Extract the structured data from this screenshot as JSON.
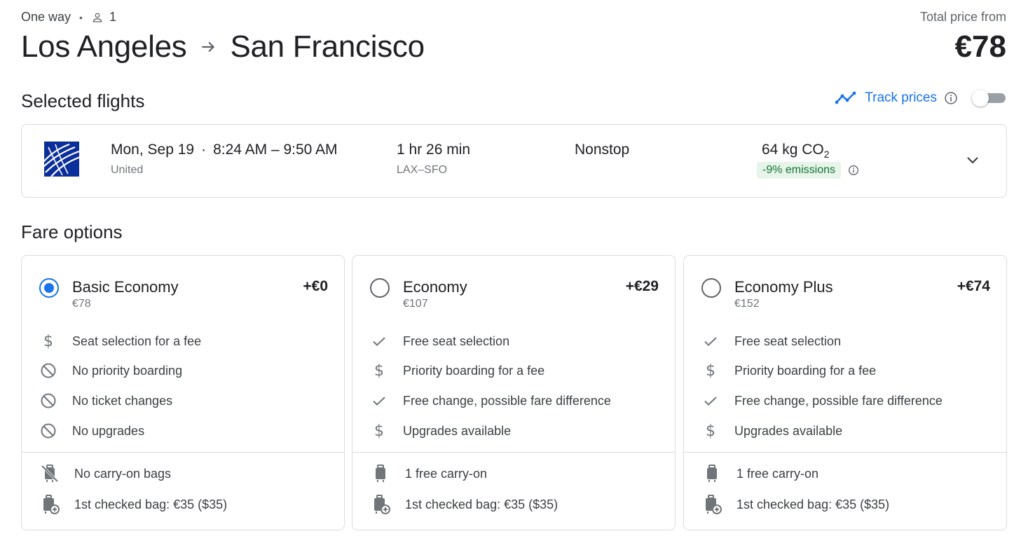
{
  "header": {
    "trip_type": "One way",
    "passengers": "1",
    "origin": "Los Angeles",
    "destination": "San Francisco",
    "total_label": "Total price from",
    "total_price": "€78"
  },
  "selected": {
    "title": "Selected flights",
    "track_label": "Track prices",
    "track_enabled": false
  },
  "flight": {
    "date": "Mon, Sep 19",
    "times": "8:24 AM – 9:50 AM",
    "airline": "United",
    "duration": "1 hr 26 min",
    "airports": "LAX–SFO",
    "stops": "Nonstop",
    "co2_value": "64 kg CO",
    "co2_sub": "2",
    "emissions": "-9% emissions"
  },
  "fare": {
    "title": "Fare options",
    "cards": [
      {
        "name": "Basic Economy",
        "base": "€78",
        "delta": "+€0",
        "selected": true,
        "features": [
          {
            "icon": "dollar-icon",
            "text": "Seat selection for a fee"
          },
          {
            "icon": "block-icon",
            "text": "No priority boarding"
          },
          {
            "icon": "block-icon",
            "text": "No ticket changes"
          },
          {
            "icon": "block-icon",
            "text": "No upgrades"
          }
        ],
        "bags": [
          {
            "icon": "no-carry-on-icon",
            "text": "No carry-on bags"
          },
          {
            "icon": "checked-bag-icon",
            "text": "1st checked bag: €35 ($35)"
          }
        ]
      },
      {
        "name": "Economy",
        "base": "€107",
        "delta": "+€29",
        "selected": false,
        "features": [
          {
            "icon": "check-icon",
            "text": "Free seat selection"
          },
          {
            "icon": "dollar-icon",
            "text": "Priority boarding for a fee"
          },
          {
            "icon": "check-icon",
            "text": "Free change, possible fare difference"
          },
          {
            "icon": "dollar-icon",
            "text": "Upgrades available"
          }
        ],
        "bags": [
          {
            "icon": "carry-on-icon",
            "text": "1 free carry-on"
          },
          {
            "icon": "checked-bag-icon",
            "text": "1st checked bag: €35 ($35)"
          }
        ]
      },
      {
        "name": "Economy Plus",
        "base": "€152",
        "delta": "+€74",
        "selected": false,
        "features": [
          {
            "icon": "check-icon",
            "text": "Free seat selection"
          },
          {
            "icon": "dollar-icon",
            "text": "Priority boarding for a fee"
          },
          {
            "icon": "check-icon",
            "text": "Free change, possible fare difference"
          },
          {
            "icon": "dollar-icon",
            "text": "Upgrades available"
          }
        ],
        "bags": [
          {
            "icon": "carry-on-icon",
            "text": "1 free carry-on"
          },
          {
            "icon": "checked-bag-icon",
            "text": "1st checked bag: €35 ($35)"
          }
        ]
      }
    ]
  },
  "colors": {
    "accent": "#1a73e8",
    "emissions_bg": "#e6f4ea",
    "emissions_text": "#137333",
    "border": "#dadce0"
  }
}
